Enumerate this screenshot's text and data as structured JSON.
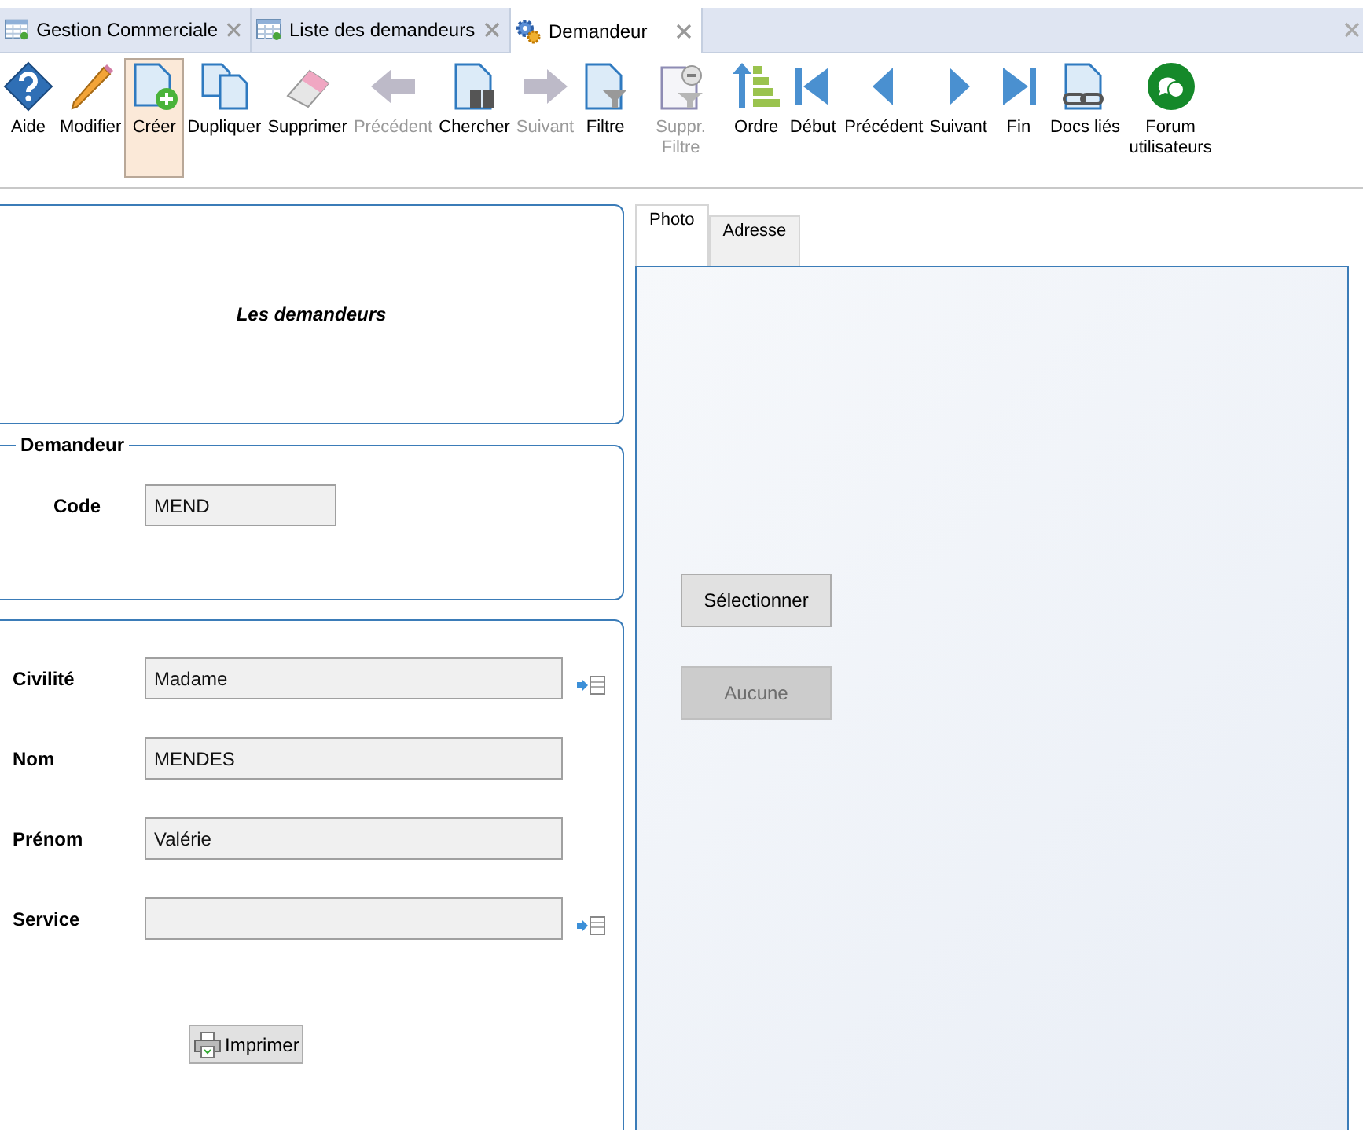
{
  "doc_tabs": [
    {
      "label": "Gestion Commerciale",
      "kind": "table",
      "selected": false
    },
    {
      "label": "Liste des demandeurs",
      "kind": "table",
      "selected": false
    },
    {
      "label": "Demandeur",
      "kind": "gears",
      "selected": true
    }
  ],
  "toolbar": [
    {
      "label": "Aide",
      "kind": "help",
      "disabled": false,
      "selected": false
    },
    {
      "label": "Modifier",
      "kind": "pencil",
      "disabled": false,
      "selected": false
    },
    {
      "label": "Créer",
      "kind": "new",
      "disabled": false,
      "selected": true
    },
    {
      "label": "Dupliquer",
      "kind": "copy",
      "disabled": false,
      "selected": false
    },
    {
      "label": "Supprimer",
      "kind": "eraser",
      "disabled": false,
      "selected": false
    },
    {
      "label": "Précédent",
      "kind": "arrow-left",
      "disabled": true,
      "selected": false
    },
    {
      "label": "Chercher",
      "kind": "search",
      "disabled": false,
      "selected": false
    },
    {
      "label": "Suivant",
      "kind": "arrow-right",
      "disabled": true,
      "selected": false
    },
    {
      "label": "Filtre",
      "kind": "filter",
      "disabled": false,
      "selected": false
    },
    {
      "label": "Suppr. Filtre",
      "kind": "filter-remove",
      "disabled": true,
      "selected": false
    },
    {
      "label": "Ordre",
      "kind": "sort",
      "disabled": false,
      "selected": false
    },
    {
      "label": "Début",
      "kind": "first",
      "disabled": false,
      "selected": false
    },
    {
      "label": "Précédent",
      "kind": "prev",
      "disabled": false,
      "selected": false
    },
    {
      "label": "Suivant",
      "kind": "next",
      "disabled": false,
      "selected": false
    },
    {
      "label": "Fin",
      "kind": "last",
      "disabled": false,
      "selected": false
    },
    {
      "label": "Docs liés",
      "kind": "docs-link",
      "disabled": false,
      "selected": false
    },
    {
      "label": "Forum utilisateurs",
      "kind": "forum",
      "disabled": false,
      "selected": false
    }
  ],
  "header": {
    "title": "Les demandeurs"
  },
  "group": {
    "legend": "Demandeur",
    "code_label": "Code",
    "code_value": "MEND"
  },
  "fields": [
    {
      "label": "Civilité",
      "value": "Madame",
      "picker": true
    },
    {
      "label": "Nom",
      "value": "MENDES",
      "picker": false
    },
    {
      "label": "Prénom",
      "value": "Valérie",
      "picker": false
    },
    {
      "label": "Service",
      "picker": true
    }
  ],
  "print_button": "Imprimer",
  "side_tabs": [
    {
      "label": "Photo",
      "selected": true
    },
    {
      "label": "Adresse",
      "selected": false
    }
  ],
  "photo_buttons": [
    {
      "label": "Sélectionner",
      "disabled": false
    },
    {
      "label": "Aucune",
      "disabled": true
    }
  ]
}
